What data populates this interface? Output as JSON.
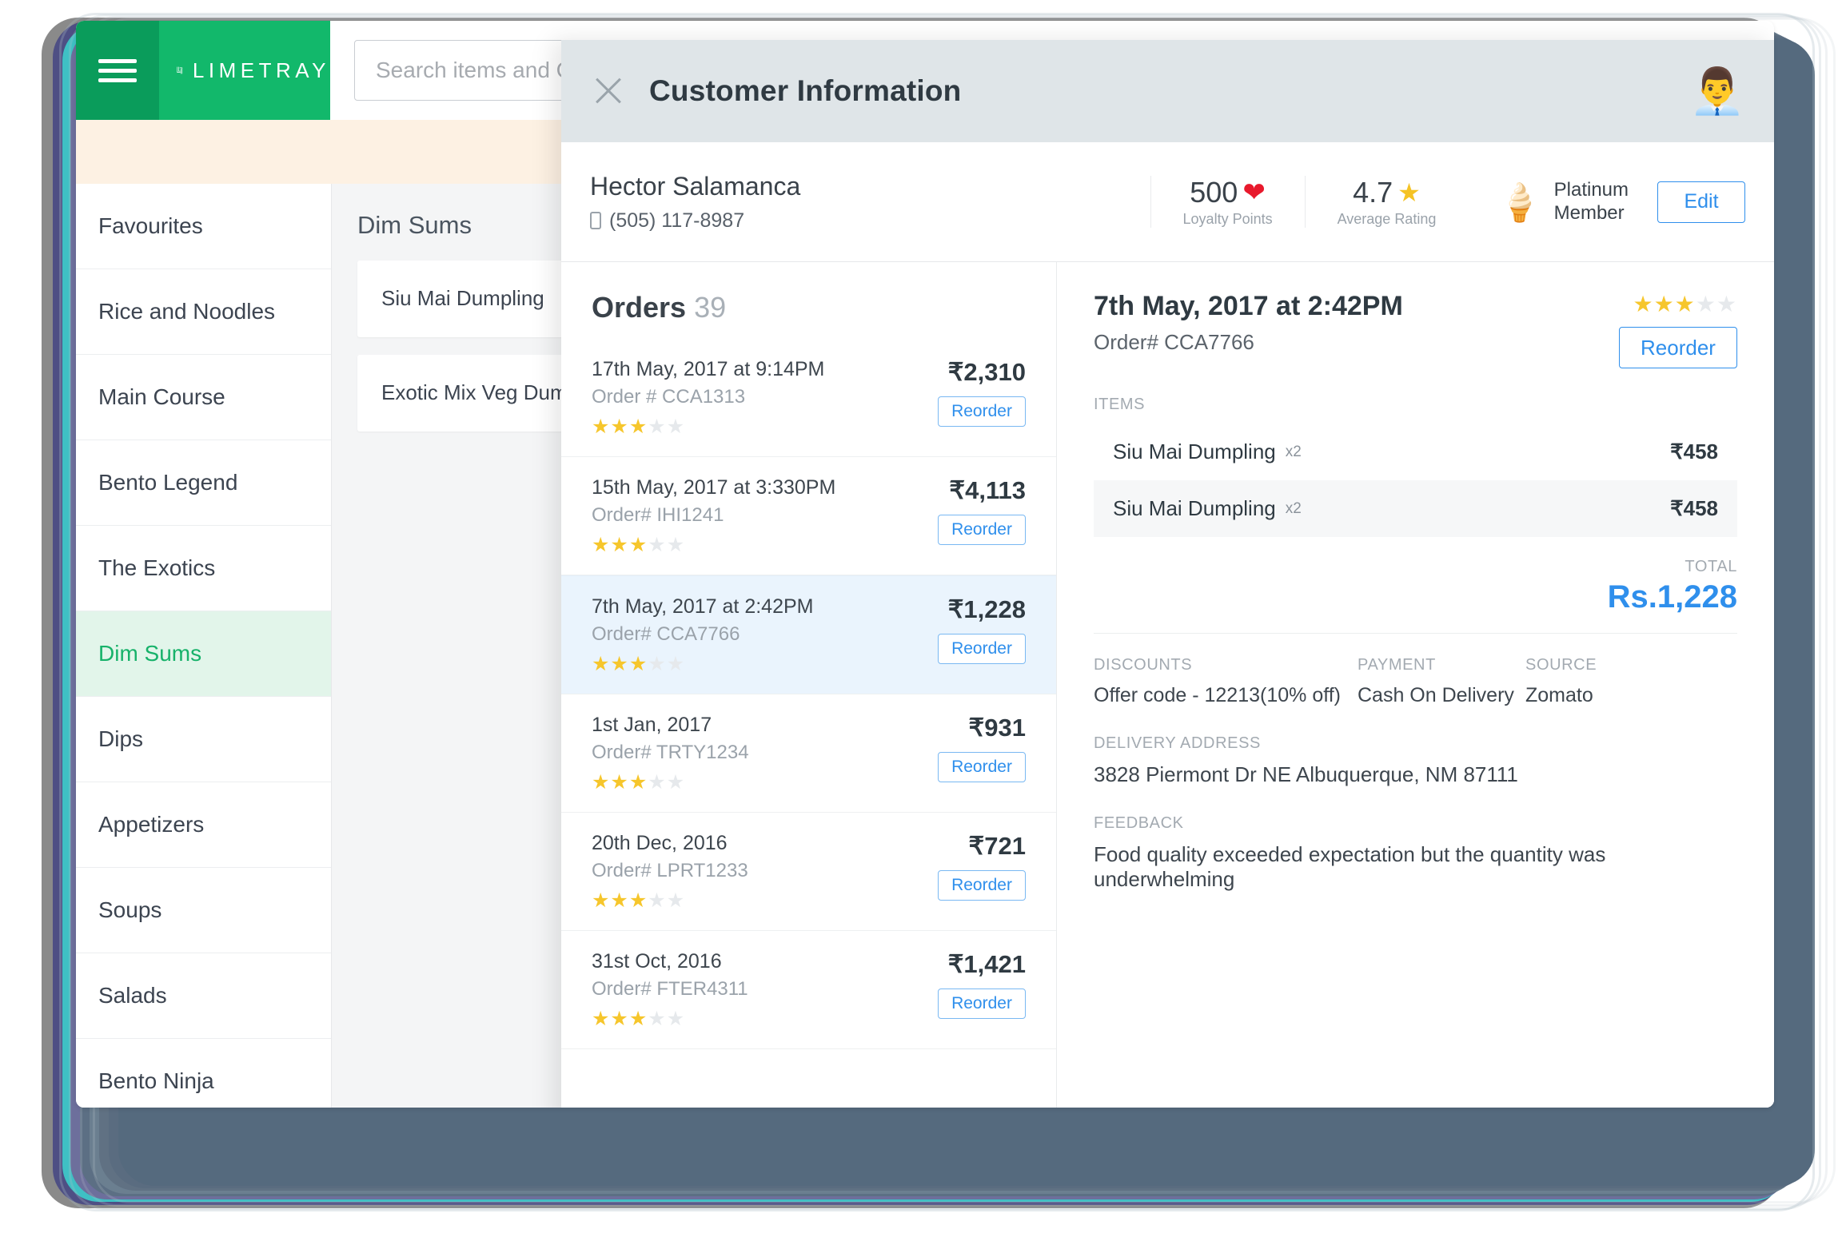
{
  "app": {
    "brand_name": "LIMETRAY",
    "search_placeholder": "Search items and C",
    "menu_icon": "hamburger-icon"
  },
  "categories": [
    {
      "label": "Favourites",
      "active": false
    },
    {
      "label": "Rice and Noodles",
      "active": false
    },
    {
      "label": "Main Course",
      "active": false
    },
    {
      "label": "Bento Legend",
      "active": false
    },
    {
      "label": "The Exotics",
      "active": false
    },
    {
      "label": "Dim Sums",
      "active": true
    },
    {
      "label": "Dips",
      "active": false
    },
    {
      "label": "Appetizers",
      "active": false
    },
    {
      "label": "Soups",
      "active": false
    },
    {
      "label": "Salads",
      "active": false
    },
    {
      "label": "Bento Ninja",
      "active": false
    }
  ],
  "item_column": {
    "title": "Dim Sums",
    "items": [
      {
        "label": "Siu Mai Dumpling"
      },
      {
        "label": "Exotic Mix Veg Dumpling"
      }
    ]
  },
  "modal": {
    "title": "Customer Information",
    "close_icon": "close-icon",
    "avatar_icon": "office-worker-avatar",
    "customer": {
      "name": "Hector Salamanca",
      "phone": "(505) 117-8987",
      "phone_icon": "mobile-phone-icon",
      "loyalty_value": "500",
      "loyalty_icon": "heart-icon",
      "loyalty_label": "Loyalty Points",
      "rating_value": "4.7",
      "rating_icon": "star-icon",
      "rating_label": "Average Rating",
      "tier_icon": "ice-cream-cone-icon",
      "tier_line1": "Platinum",
      "tier_line2": "Member",
      "edit_label": "Edit"
    },
    "orders": {
      "heading": "Orders",
      "count": "39",
      "reorder_label": "Reorder",
      "list": [
        {
          "date": "17th May, 2017 at 9:14PM",
          "number": "Order # CCA1313",
          "amount": "₹2,310",
          "rating": 3,
          "selected": false
        },
        {
          "date": "15th May, 2017 at 3:330PM",
          "number": "Order# IHI1241",
          "amount": "₹4,113",
          "rating": 3,
          "selected": false
        },
        {
          "date": "7th May, 2017 at 2:42PM",
          "number": "Order# CCA7766",
          "amount": "₹1,228",
          "rating": 3,
          "selected": true
        },
        {
          "date": "1st Jan, 2017",
          "number": "Order# TRTY1234",
          "amount": "₹931",
          "rating": 3,
          "selected": false
        },
        {
          "date": "20th Dec, 2016",
          "number": "Order# LPRT1233",
          "amount": "₹721",
          "rating": 3,
          "selected": false
        },
        {
          "date": "31st Oct, 2016",
          "number": "Order# FTER4311",
          "amount": "₹1,421",
          "rating": 3,
          "selected": false
        }
      ]
    },
    "detail": {
      "date": "7th May, 2017 at 2:42PM",
      "number": "Order# CCA7766",
      "rating": 3,
      "reorder_label": "Reorder",
      "items_label": "ITEMS",
      "items": [
        {
          "name": "Siu Mai Dumpling",
          "qty": "x2",
          "amount": "₹458"
        },
        {
          "name": "Siu Mai Dumpling",
          "qty": "x2",
          "amount": "₹458"
        }
      ],
      "total_label": "TOTAL",
      "total_value": "Rs.1,228",
      "discounts_label": "DISCOUNTS",
      "discounts_value": "Offer code - 12213(10% off)",
      "payment_label": "PAYMENT",
      "payment_value": "Cash On Delivery",
      "source_label": "SOURCE",
      "source_value": "Zomato",
      "address_label": "DELIVERY ADDRESS",
      "address_value": "3828 Piermont Dr NE Albuquerque, NM 87111",
      "feedback_label": "FEEDBACK",
      "feedback_value": "Food quality exceeded expectation but the quantity was underwhelming"
    }
  },
  "theme": {
    "brand_green": "#12b86b",
    "brand_green_dark": "#0a9c5b",
    "accent_blue": "#2f8fec",
    "star_yellow": "#f6c62c",
    "heart_red": "#e8192c"
  }
}
